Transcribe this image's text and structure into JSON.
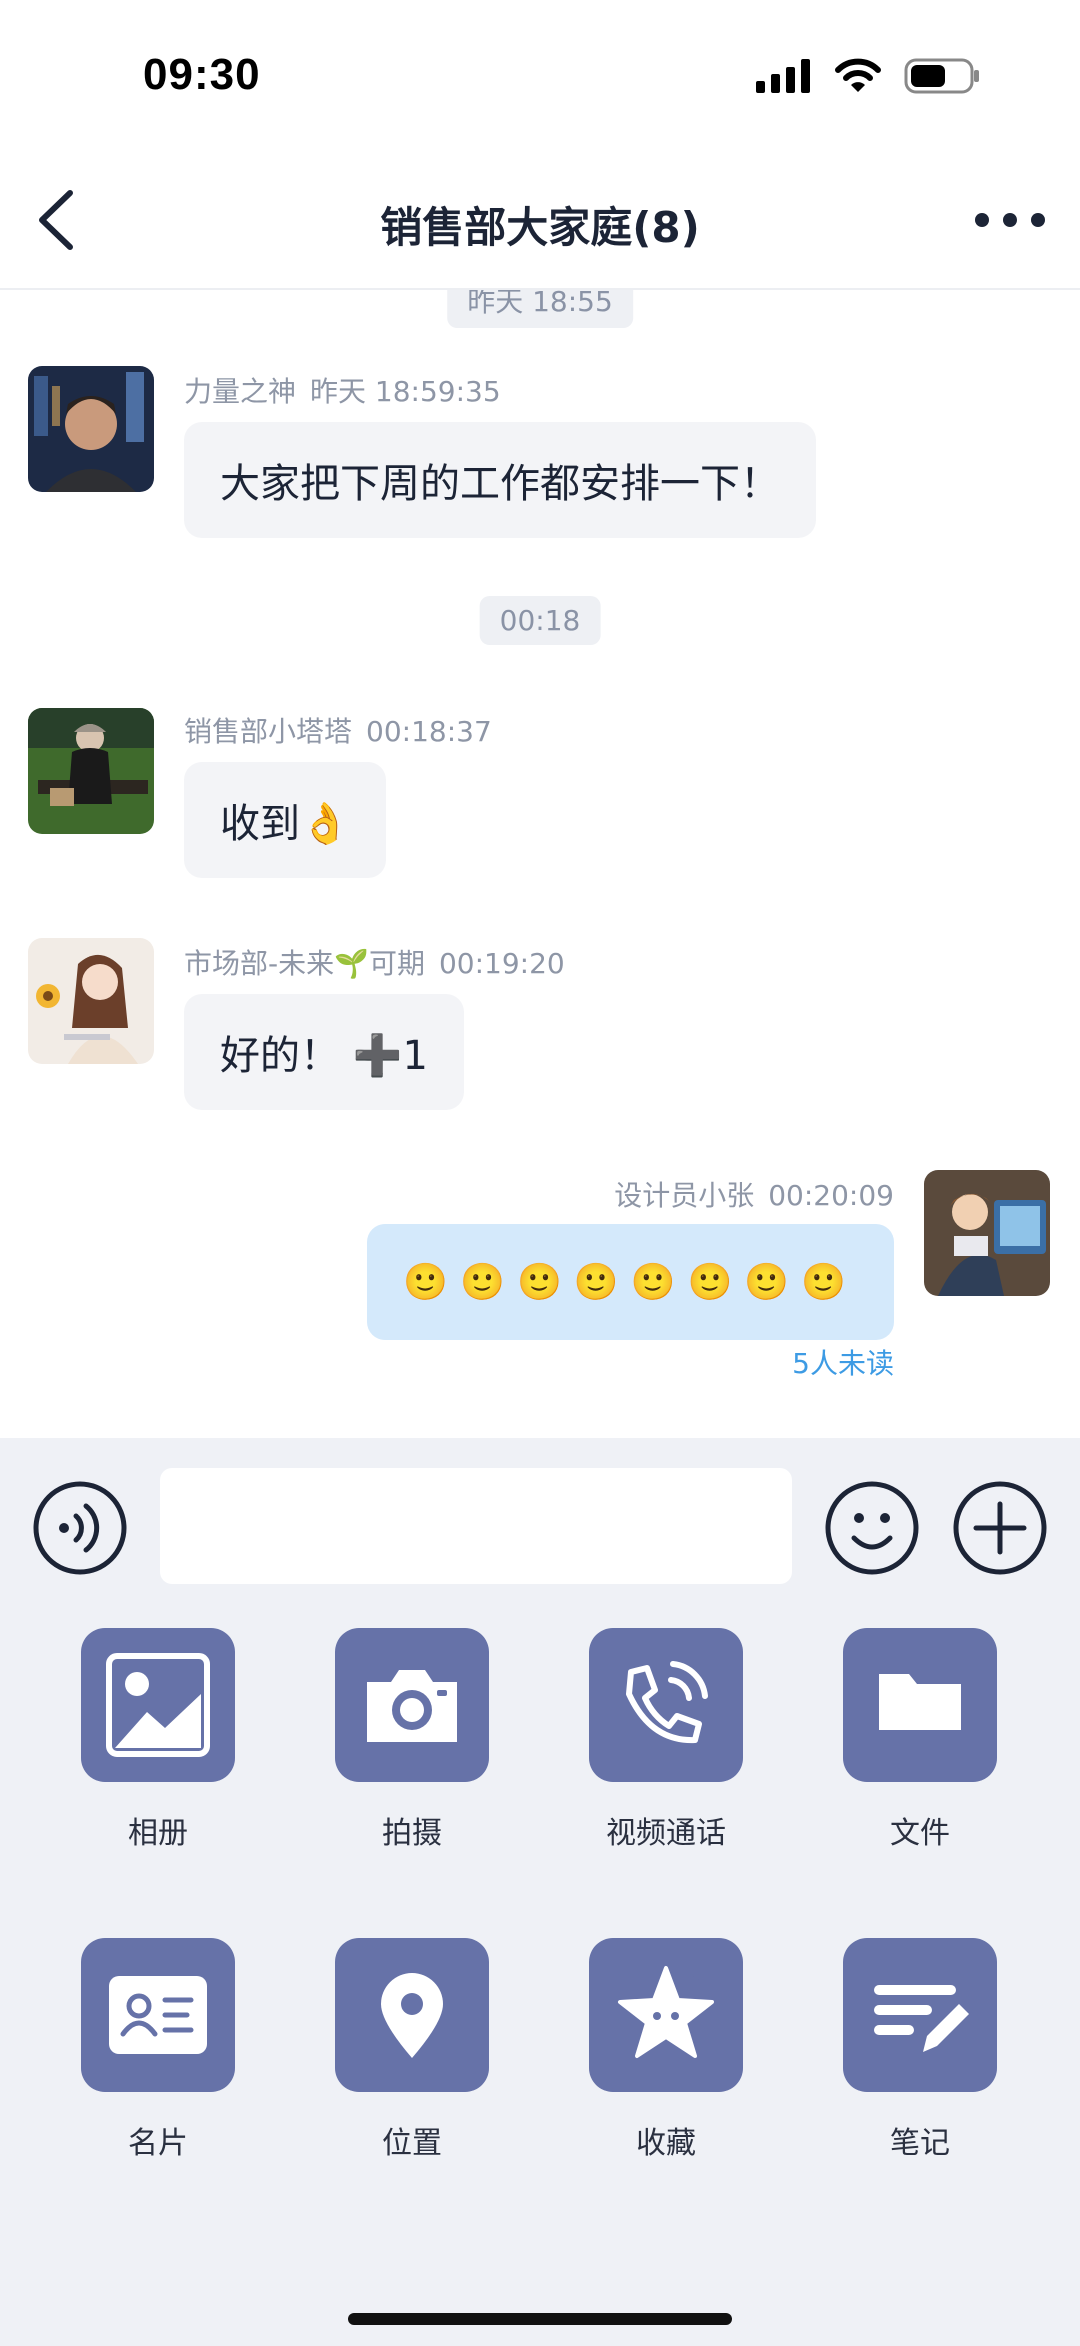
{
  "status": {
    "time": "09:30"
  },
  "header": {
    "title": "销售部大家庭(8)"
  },
  "chat": {
    "partial_time": "昨天 18:55",
    "messages": [
      {
        "sender": "力量之神",
        "time": "昨天 18:59:35",
        "text": "大家把下周的工作都安排一下！",
        "mine": false
      },
      {
        "separator": "00:18"
      },
      {
        "sender": "销售部小塔塔",
        "time": "00:18:37",
        "text": "收到👌",
        "mine": false
      },
      {
        "sender": "市场部-未来🌱可期",
        "time": "00:19:20",
        "text": "好的！ ➕1",
        "mine": false
      },
      {
        "sender": "设计员小张",
        "time": "00:20:09",
        "text": "🙂🙂🙂🙂🙂🙂🙂🙂",
        "mine": true,
        "read_status": "5人未读"
      }
    ]
  },
  "input": {
    "placeholder": ""
  },
  "tools": [
    {
      "label": "相册",
      "icon": "photo-album-icon"
    },
    {
      "label": "拍摄",
      "icon": "camera-icon"
    },
    {
      "label": "视频通话",
      "icon": "video-call-icon"
    },
    {
      "label": "文件",
      "icon": "folder-icon"
    },
    {
      "label": "名片",
      "icon": "business-card-icon"
    },
    {
      "label": "位置",
      "icon": "location-pin-icon"
    },
    {
      "label": "收藏",
      "icon": "favorite-star-icon"
    },
    {
      "label": "笔记",
      "icon": "note-pencil-icon"
    }
  ],
  "colors": {
    "accent_tile": "#6672a8",
    "my_bubble": "#d4e9fb",
    "other_bubble": "#f3f4f7",
    "unread_text": "#3d9be4"
  }
}
